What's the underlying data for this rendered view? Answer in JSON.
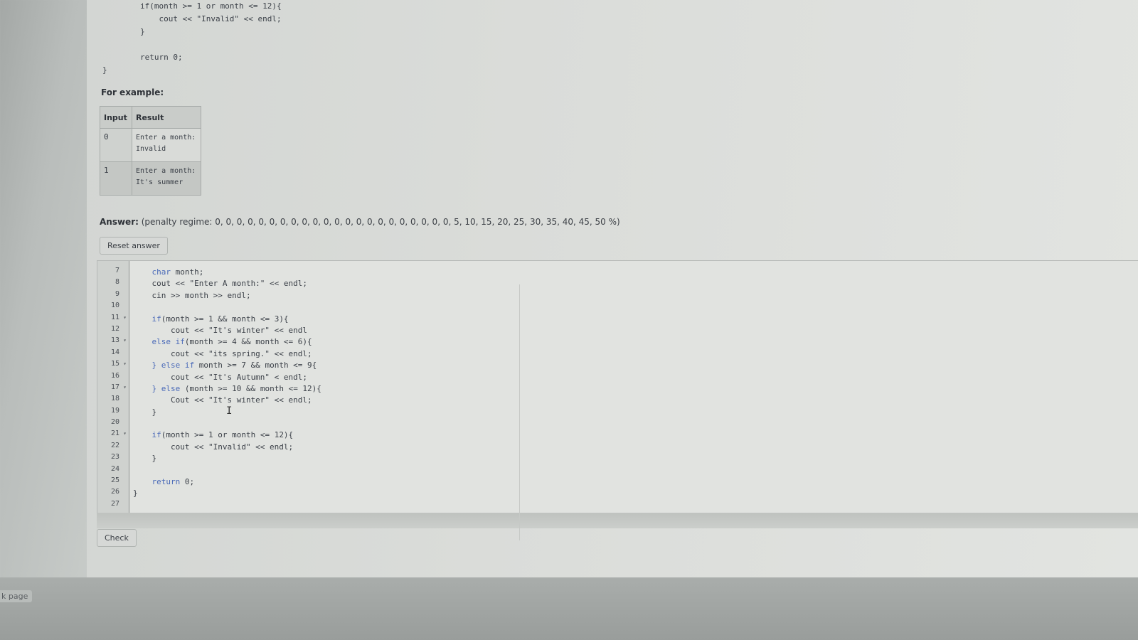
{
  "top_code": [
    "        if(month >= 1 or month <= 12){",
    "            cout << \"Invalid\" << endl;",
    "        }",
    "",
    "        return 0;",
    "}"
  ],
  "for_example": "For example:",
  "example_table": {
    "headers": [
      "Input",
      "Result"
    ],
    "rows": [
      {
        "input": "0",
        "result": [
          "Enter a month:",
          "Invalid"
        ]
      },
      {
        "input": "1",
        "result": [
          "Enter a month:",
          "It's summer"
        ]
      }
    ]
  },
  "answer": {
    "label": "Answer:",
    "penalty": "(penalty regime: 0, 0, 0, 0, 0, 0, 0, 0, 0, 0, 0, 0, 0, 0, 0, 0, 0, 0, 0, 0, 0, 0, 5, 10, 15, 20, 25, 30, 35, 40, 45, 50 %)"
  },
  "reset_button": "Reset answer",
  "check_button": "Check",
  "editor": {
    "line_numbers": [
      "7",
      "8",
      "9",
      "10",
      "11",
      "12",
      "13",
      "14",
      "15",
      "16",
      "17",
      "18",
      "19",
      "20",
      "21",
      "22",
      "23",
      "24",
      "25",
      "26",
      "27"
    ],
    "folds": [
      "",
      "",
      "",
      "",
      "▾",
      "",
      "▾",
      "",
      "▾",
      "",
      "▾",
      "",
      "",
      "",
      "▾",
      "",
      "",
      "",
      "",
      "",
      ""
    ],
    "lines": [
      "    char month;",
      "    cout << \"Enter A month:\" << endl;",
      "    cin >> month >> endl;",
      "",
      "    if(month >= 1 && month <= 3){",
      "        cout << \"It's winter\" << endl",
      "    else if(month >= 4 && month <= 6){",
      "        cout << \"its spring.\" << endl;",
      "    } else if month >= 7 && month <= 9{",
      "        cout << \"It's Autumn\" < endl;",
      "    } else (month >= 10 && month <= 12){",
      "        Cout << \"It's winter\" << endl;",
      "    }",
      "",
      "    if(month >= 1 or month <= 12){",
      "        cout << \"Invalid\" << endl;",
      "    }",
      "",
      "    return 0;",
      "}",
      ""
    ]
  },
  "cursor_glyph": "I",
  "side_text": "k page"
}
